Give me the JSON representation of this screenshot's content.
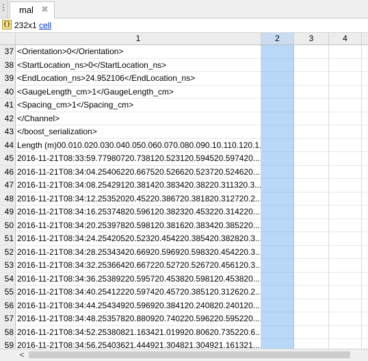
{
  "tab": {
    "label": "mal",
    "close_glyph": "✖"
  },
  "infobar": {
    "icon_text": "{}",
    "size": "232x1",
    "class_link": "cell"
  },
  "columns": [
    "1",
    "2",
    "3",
    "4"
  ],
  "rows": [
    {
      "num": "37",
      "value": "<Orientation>0</Orientation>"
    },
    {
      "num": "38",
      "value": "<StartLocation_ns>0</StartLocation_ns>"
    },
    {
      "num": "39",
      "value": "<EndLocation_ns>24.952106</EndLocation_ns>"
    },
    {
      "num": "40",
      "value": "<GaugeLength_cm>1</GaugeLength_cm>"
    },
    {
      "num": "41",
      "value": "<Spacing_cm>1</Spacing_cm>"
    },
    {
      "num": "42",
      "value": "</Channel>"
    },
    {
      "num": "43",
      "value": "</boost_serialization>"
    },
    {
      "num": "44",
      "value": "Length (m)00.010.020.030.040.050.060.070.080.090.10.110.120.1..."
    },
    {
      "num": "45",
      "value": "2016-11-21T08:33:59.77980720.738120.523120.594520.597420...."
    },
    {
      "num": "46",
      "value": "2016-11-21T08:34:04.25406220.667520.526620.523720.524620...."
    },
    {
      "num": "47",
      "value": "2016-11-21T08:34:08.25429120.381420.383420.38220.311320.3..."
    },
    {
      "num": "48",
      "value": "2016-11-21T08:34:12.25352020.45220.386720.381820.312720.2..."
    },
    {
      "num": "49",
      "value": "2016-11-21T08:34:16.25374820.596120.382320.453220.314220...."
    },
    {
      "num": "50",
      "value": "2016-11-21T08:34:20.25397820.598120.381620.383420.385220...."
    },
    {
      "num": "51",
      "value": "2016-11-21T08:34:24.25420520.52320.454220.385420.382820.3..."
    },
    {
      "num": "52",
      "value": "2016-11-21T08:34:28.25343420.66920.596920.598320.454220.3..."
    },
    {
      "num": "53",
      "value": "2016-11-21T08:34:32.25366420.667220.52720.526720.456120.3..."
    },
    {
      "num": "54",
      "value": "2016-11-21T08:34:36.25389220.595720.453820.598120.453820...."
    },
    {
      "num": "55",
      "value": "2016-11-21T08:34:40.25412220.597420.45720.385120.312620.2..."
    },
    {
      "num": "56",
      "value": "2016-11-21T08:34:44.25434920.596920.384120.240820.240120...."
    },
    {
      "num": "57",
      "value": "2016-11-21T08:34:48.25357820.880920.740220.596220.595220...."
    },
    {
      "num": "58",
      "value": "2016-11-21T08:34:52.25380821.163421.019920.80620.735220.6..."
    },
    {
      "num": "59",
      "value": "2016-11-21T08:34:56.25403621.444921.304821.304921.161321...."
    }
  ],
  "scrollbar": {
    "left_arrow": "<"
  }
}
